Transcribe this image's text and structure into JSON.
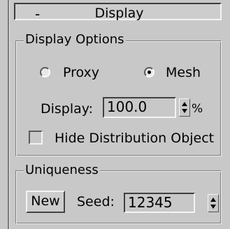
{
  "rollout": {
    "toggle_symbol": "-",
    "title": "Display"
  },
  "display_options": {
    "group_label": "Display Options",
    "radio_proxy": {
      "label": "Proxy",
      "selected": false
    },
    "radio_mesh": {
      "label": "Mesh",
      "selected": true
    },
    "display_label": "Display:",
    "display_value": "100.0",
    "display_unit": "%",
    "hide_distribution": {
      "label": "Hide Distribution Object",
      "checked": false
    }
  },
  "uniqueness": {
    "group_label": "Uniqueness",
    "new_button": "New",
    "seed_label": "Seed:",
    "seed_value": "12345"
  }
}
